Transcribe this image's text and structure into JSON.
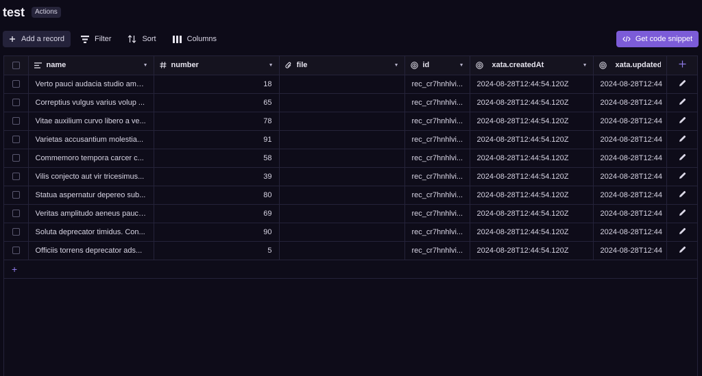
{
  "header": {
    "title": "test",
    "actions_label": "Actions"
  },
  "toolbar": {
    "add_record": "Add a record",
    "filter": "Filter",
    "sort": "Sort",
    "columns": "Columns",
    "code_snippet": "Get code snippet"
  },
  "table": {
    "columns": {
      "name": "name",
      "number": "number",
      "file": "file",
      "id": "id",
      "created": "xata.createdAt",
      "updated": "xata.updatedAt"
    },
    "rows": [
      {
        "name": "Verto pauci audacia studio amo...",
        "number": "18",
        "file": "",
        "id": "rec_cr7hnhlvi...",
        "created": "2024-08-28T12:44:54.120Z",
        "updated": "2024-08-28T12:44"
      },
      {
        "name": "Correptius vulgus varius volup ...",
        "number": "65",
        "file": "",
        "id": "rec_cr7hnhlvi...",
        "created": "2024-08-28T12:44:54.120Z",
        "updated": "2024-08-28T12:44"
      },
      {
        "name": "Vitae auxilium curvo libero a ve...",
        "number": "78",
        "file": "",
        "id": "rec_cr7hnhlvi...",
        "created": "2024-08-28T12:44:54.120Z",
        "updated": "2024-08-28T12:44"
      },
      {
        "name": "Varietas accusantium molestia...",
        "number": "91",
        "file": "",
        "id": "rec_cr7hnhlvi...",
        "created": "2024-08-28T12:44:54.120Z",
        "updated": "2024-08-28T12:44"
      },
      {
        "name": "Commemoro tempora carcer c...",
        "number": "58",
        "file": "",
        "id": "rec_cr7hnhlvi...",
        "created": "2024-08-28T12:44:54.120Z",
        "updated": "2024-08-28T12:44"
      },
      {
        "name": "Vilis conjecto aut vir tricesimus...",
        "number": "39",
        "file": "",
        "id": "rec_cr7hnhlvi...",
        "created": "2024-08-28T12:44:54.120Z",
        "updated": "2024-08-28T12:44"
      },
      {
        "name": "Statua aspernatur depereo sub...",
        "number": "80",
        "file": "",
        "id": "rec_cr7hnhlvi...",
        "created": "2024-08-28T12:44:54.120Z",
        "updated": "2024-08-28T12:44"
      },
      {
        "name": "Veritas amplitudo aeneus pauci...",
        "number": "69",
        "file": "",
        "id": "rec_cr7hnhlvi...",
        "created": "2024-08-28T12:44:54.120Z",
        "updated": "2024-08-28T12:44"
      },
      {
        "name": "Soluta deprecator timidus. Con...",
        "number": "90",
        "file": "",
        "id": "rec_cr7hnhlvi...",
        "created": "2024-08-28T12:44:54.120Z",
        "updated": "2024-08-28T12:44"
      },
      {
        "name": "Officiis torrens deprecator ads...",
        "number": "5",
        "file": "",
        "id": "rec_cr7hnhlvi...",
        "created": "2024-08-28T12:44:54.120Z",
        "updated": "2024-08-28T12:44"
      }
    ]
  },
  "add_row_symbol": "+",
  "colors": {
    "accent": "#7c5cd8",
    "background": "#0d0b18",
    "border": "#25233a"
  }
}
